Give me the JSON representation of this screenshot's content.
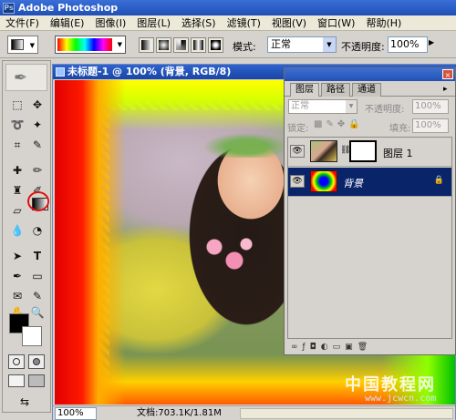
{
  "app": {
    "title": "Adobe Photoshop",
    "logo_text": "Ps"
  },
  "menu": [
    "文件(F)",
    "编辑(E)",
    "图像(I)",
    "图层(L)",
    "选择(S)",
    "滤镜(T)",
    "视图(V)",
    "窗口(W)",
    "帮助(H)"
  ],
  "options": {
    "mode_label": "模式:",
    "mode_value": "正常",
    "opacity_label": "不透明度:",
    "opacity_value": "100%"
  },
  "document": {
    "title": "未标题-1 @ 100% (背景, RGB/8)",
    "zoom": "100%",
    "doc_info": "文档:703.1K/1.81M"
  },
  "layers_panel": {
    "tabs": [
      "图层",
      "路径",
      "通道"
    ],
    "blend_mode": "正常",
    "opacity_label": "不透明度:",
    "opacity_value": "100%",
    "lock_label": "锁定:",
    "fill_label": "填充:",
    "fill_value": "100%",
    "layers": [
      {
        "name": "图层 1",
        "selected": false,
        "visible": true
      },
      {
        "name": "背景",
        "selected": true,
        "visible": true,
        "locked": true
      }
    ]
  },
  "watermark": {
    "text": "中国教程网",
    "url": "www.jcwcn.com"
  },
  "colors": {
    "foreground": "#000000",
    "background": "#ffffff",
    "selection": "#0a246a",
    "titlebar": "#2452b4"
  }
}
